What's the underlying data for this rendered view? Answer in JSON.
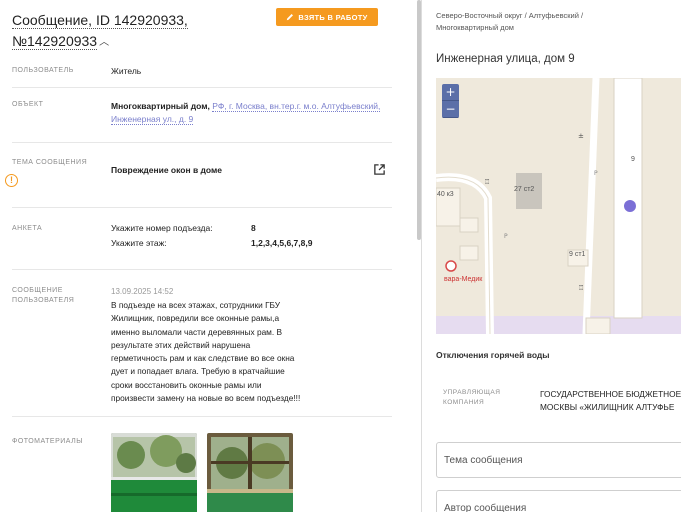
{
  "header": {
    "title_line1": "Сообщение, ID 142920933,",
    "title_line2": "№142920933",
    "take_button": "ВЗЯТЬ В РАБОТУ"
  },
  "fields": {
    "user_label": "ПОЛЬЗОВАТЕЛЬ",
    "user_value": "Житель",
    "object_label": "ОБЪЕКТ",
    "object_prefix": "Многоквартирный дом,",
    "object_link1": "РФ, г. Москва, вн.тер.г. м.о. Алтуфьевский,",
    "object_link2": "Инженерная ул., д. 9",
    "topic_label": "ТЕМА СООБЩЕНИЯ",
    "topic_value": "Повреждение окон в доме",
    "survey_label": "АНКЕТА",
    "survey": [
      {
        "q": "Укажите номер подъезда:",
        "a": "8"
      },
      {
        "q": "Укажите этаж:",
        "a": "1,2,3,4,5,6,7,8,9"
      }
    ],
    "message_label1": "СООБЩЕНИЕ",
    "message_label2": "ПОЛЬЗОВАТЕЛЯ",
    "message_date": "13.09.2025 14:52",
    "message_lines": [
      "В подъезде на всех этажах, сотрудники ГБУ",
      "Жилищник, повредили все оконные рамы,а",
      "именно выломали части деревянных рам. В",
      "результате этих действий нарушена",
      "герметичность рам и как следствие во все окна",
      "дует и попадает влага. Требую в кратчайшие",
      "сроки восстановить оконные рамы или",
      "произвести замену на новые во всем подъезде!!!"
    ],
    "photos_label": "ФОТОМАТЕРИАЛЫ"
  },
  "right": {
    "breadcrumb_line1": "Северо-Восточный округ / Алтуфьевский /",
    "breadcrumb_line2": "Многоквартирный дом",
    "address": "Инженерная улица, дом 9",
    "map": {
      "zoom_in": "+",
      "zoom_out": "−",
      "labels": {
        "house9": "9",
        "b27": "27 ст2",
        "b40": "40 к3",
        "b9": "9 ст1",
        "medic": "вара-Медик"
      }
    },
    "hot_water": "Отключения горячей воды",
    "uk_label1": "УПРАВЛЯЮЩАЯ",
    "uk_label2": "КОМПАНИЯ",
    "uk_value1": "ГОСУДАРСТВЕННОЕ БЮДЖЕТНОЕ",
    "uk_value2": "МОСКВЫ «ЖИЛИЩНИК АЛТУФЬЕ",
    "topic_placeholder": "Тема сообщения",
    "author_placeholder": "Автор сообщения"
  },
  "colors": {
    "accent": "#f59a1f",
    "link": "#7a7fcc",
    "map_marker": "#7b6fd6",
    "zoom": "#5b6fa8"
  }
}
